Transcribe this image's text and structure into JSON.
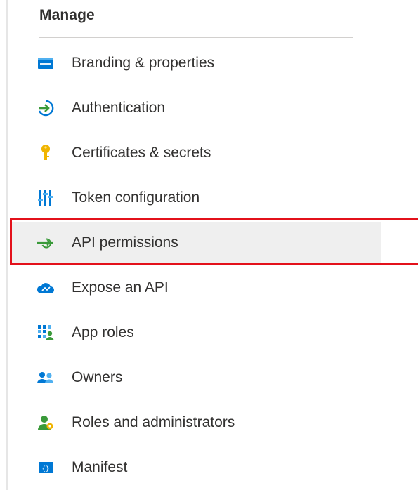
{
  "section": {
    "title": "Manage"
  },
  "nav": {
    "items": [
      {
        "label": "Branding & properties",
        "icon": "branding-icon"
      },
      {
        "label": "Authentication",
        "icon": "authentication-icon"
      },
      {
        "label": "Certificates & secrets",
        "icon": "key-icon"
      },
      {
        "label": "Token configuration",
        "icon": "token-configuration-icon"
      },
      {
        "label": "API permissions",
        "icon": "api-permissions-icon",
        "selected": true
      },
      {
        "label": "Expose an API",
        "icon": "cloud-icon"
      },
      {
        "label": "App roles",
        "icon": "app-roles-icon"
      },
      {
        "label": "Owners",
        "icon": "owners-icon"
      },
      {
        "label": "Roles and administrators",
        "icon": "roles-administrators-icon"
      },
      {
        "label": "Manifest",
        "icon": "manifest-icon"
      }
    ]
  },
  "colors": {
    "highlight": "#e3111b",
    "selected_bg": "#efefef",
    "icon_blue": "#0078d4",
    "icon_green": "#3a9a3a",
    "key_yellow": "#f0b400",
    "text": "#323130"
  }
}
